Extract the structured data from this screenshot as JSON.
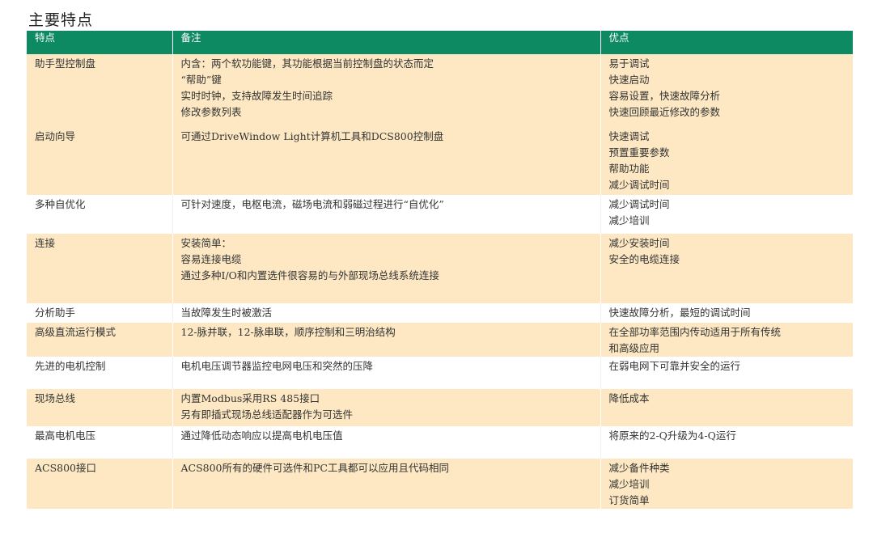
{
  "title": "主要特点",
  "headers": [
    "特点",
    "备注",
    "优点"
  ],
  "rows": [
    {
      "feature": "助手型控制盘",
      "notes": [
        "内含：两个软功能键，其功能根据当前控制盘的状态而定",
        "“帮助”键",
        "实时时钟，支持故障发生时间追踪",
        "修改参数列表"
      ],
      "benefits": [
        "易于调试",
        "快速启动",
        "容易设置，快速故障分析",
        "快速回顾最近修改的参数"
      ]
    },
    {
      "feature": "启动向导",
      "notes": [
        "可通过DriveWindow Light计算机工具和DCS800控制盘"
      ],
      "benefits": [
        "快速调试",
        "预置重要参数",
        "帮助功能",
        "减少调试时间"
      ]
    },
    {
      "feature": "多种自优化",
      "notes": [
        "可针对速度，电枢电流，磁场电流和弱磁过程进行“自优化”"
      ],
      "benefits": [
        "减少调试时间",
        "减少培训"
      ]
    },
    {
      "feature": "连接",
      "notes": [
        "安装简单：",
        "容易连接电缆",
        "通过多种I/O和内置选件很容易的与外部现场总线系统连接"
      ],
      "benefits": [
        "减少安装时间",
        "安全的电缆连接"
      ]
    },
    {
      "feature": "分析助手",
      "notes": [
        "当故障发生时被激活"
      ],
      "benefits": [
        "快速故障分析，最短的调试时间"
      ]
    },
    {
      "feature": "高级直流运行模式",
      "notes": [
        "12-脉并联，12-脉串联，顺序控制和三明治结构"
      ],
      "benefits": [
        "在全部功率范围内传动适用于所有传统",
        "和高级应用"
      ]
    },
    {
      "feature": "先进的电机控制",
      "notes": [
        "电机电压调节器监控电网电压和突然的压降"
      ],
      "benefits": [
        "在弱电网下可靠并安全的运行"
      ]
    },
    {
      "feature": "现场总线",
      "notes": [
        "内置Modbus采用RS 485接口",
        "另有即插式现场总线适配器作为可选件"
      ],
      "benefits": [
        "降低成本"
      ]
    },
    {
      "feature": "最高电机电压",
      "notes": [
        "通过降低动态响应以提高电机电压值"
      ],
      "benefits": [
        "将原来的2-Q升级为4-Q运行"
      ]
    },
    {
      "feature": "ACS800接口",
      "notes": [
        "ACS800所有的硬件可选件和PC工具都可以应用且代码相同"
      ],
      "benefits": [
        "减少备件种类",
        "减少培训",
        "订货简单"
      ]
    }
  ],
  "colors": {
    "header_bg": "#0e8a63",
    "row_alt_bg": "#fde8c3",
    "row_plain_bg": "#ffffff"
  }
}
